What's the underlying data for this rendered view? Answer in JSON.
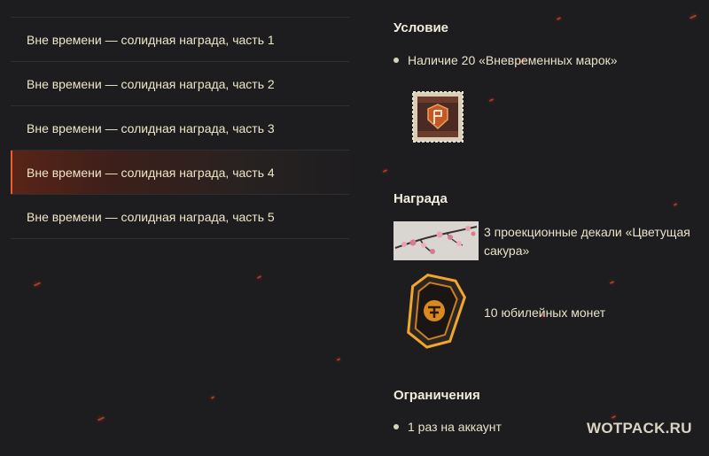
{
  "quest_list": {
    "items": [
      {
        "label": "Вне времени — солидная награда, часть 1"
      },
      {
        "label": "Вне времени — солидная награда, часть 2"
      },
      {
        "label": "Вне времени — солидная награда, часть 3"
      },
      {
        "label": "Вне времени — солидная награда, часть 4"
      },
      {
        "label": "Вне времени — солидная награда, часть 5"
      }
    ],
    "active_index": 3
  },
  "details": {
    "condition": {
      "title": "Условие",
      "text": "Наличие 20 «Вневременных марок»",
      "icon": "timeless-stamp-icon"
    },
    "reward": {
      "title": "Награда",
      "items": [
        {
          "text": "3 проекционные декали «Цветущая сакура»",
          "icon": "cherry-blossom-decal-icon"
        },
        {
          "text": "10 юбилейных монет",
          "icon": "anniversary-coin-icon"
        }
      ]
    },
    "restrictions": {
      "title": "Ограничения",
      "text": "1 раз на аккаунт"
    }
  },
  "watermark": "WOTPACK.RU",
  "colors": {
    "background": "#1d1c1f",
    "accent": "#ef5a31",
    "text": "#e9e3c9"
  }
}
